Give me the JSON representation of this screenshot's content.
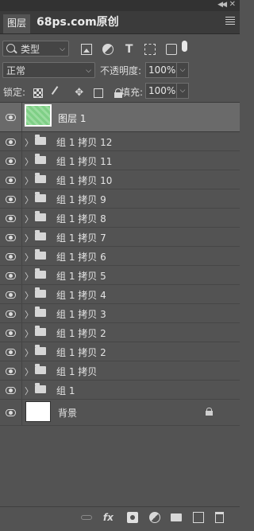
{
  "panel": {
    "tab_label": "图层",
    "watermark": "68ps.com原创"
  },
  "filter": {
    "kind_label": "类型",
    "icons": [
      "image-filter-icon",
      "adjustment-filter-icon",
      "text-filter-icon",
      "shape-filter-icon",
      "smart-object-filter-icon"
    ]
  },
  "blend": {
    "mode": "正常",
    "opacity_label": "不透明度:",
    "opacity_value": "100%"
  },
  "lock": {
    "label": "锁定:",
    "fill_label": "填充:",
    "fill_value": "100%"
  },
  "layers": {
    "selected_name": "图层 1",
    "groups": [
      "组 1 拷贝 12",
      "组 1 拷贝 11",
      "组 1 拷贝 10",
      "组 1 拷贝 9",
      "组 1 拷贝 8",
      "组 1 拷贝 7",
      "组 1 拷贝 6",
      "组 1 拷贝 5",
      "组 1 拷贝 4",
      "组 1 拷贝 3",
      "组 1 拷贝 2",
      "组 1 拷贝 2",
      "组 1 拷贝",
      "组 1"
    ],
    "background_name": "背景"
  },
  "bottom": {
    "fx_label": "fx"
  }
}
